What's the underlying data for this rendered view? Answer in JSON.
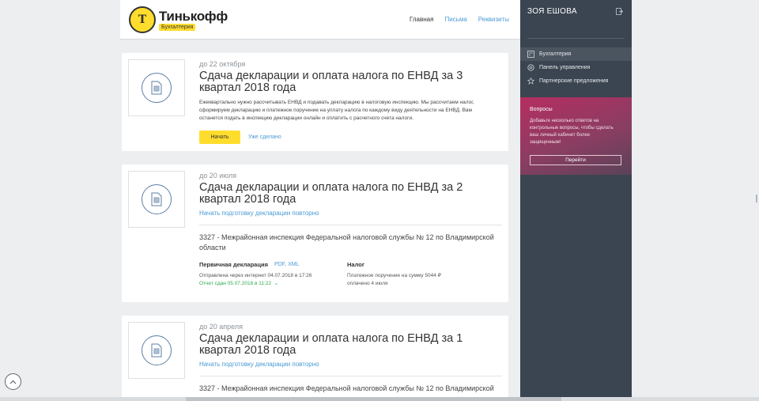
{
  "header": {
    "logo_name": "Тинькофф",
    "logo_badge": "Бухгалтерия",
    "nav": {
      "home": "Главная",
      "letters": "Письма",
      "requisites": "Реквизиты"
    }
  },
  "cards": [
    {
      "due": "до 22 октября",
      "title": "Сдача декларации и оплата налога по ЕНВД за 3 квартал 2018 года",
      "description": "Ежеквартально нужно рассчитывать ЕНВД и подавать декларацию в налоговую инспекцию. Мы рассчитаем налог, сформируем декларацию и платежное поручение на уплату налога по каждому виду деятельности на ЕНВД. Вам останется подать в инспекцию декларации онлайн и оплатить с расчетного счета налоги.",
      "start_label": "Начать",
      "done_label": "Уже сделано"
    },
    {
      "due": "до 20 июля",
      "title": "Сдача декларации и оплата налога по ЕНВД за 2 квартал 2018 года",
      "repeat_link": "Начать подготовку декларации повторно",
      "inspection": "3327 - Межрайонная инспекция Федеральной налоговой службы № 12 по Владимирской области",
      "declaration_head": "Первичная декларация",
      "declaration_files": "PDF, XML",
      "declaration_sent": "Отправлена через интернет 04.07.2018 в 17:26",
      "declaration_report": "Отчет сдан 05.07.2018 в 11:22",
      "tax_head": "Налог",
      "tax_text": "Платежное поручение на сумму 5044 ₽",
      "tax_paid": "оплачено 4 июля"
    },
    {
      "due": "до 20 апреля",
      "title": "Сдача декларации и оплата налога по ЕНВД за 1 квартал 2018 года",
      "repeat_link": "Начать подготовку декларации повторно",
      "inspection": "3327 - Межрайонная инспекция Федеральной налоговой службы № 12 по Владимирской"
    }
  ],
  "sidebar": {
    "user_name": "ЗОЯ ЕШОВА",
    "menu": [
      {
        "label": "Бухгалтерия",
        "icon": "calculator-icon",
        "active": true
      },
      {
        "label": "Панель управления",
        "icon": "gear-icon",
        "active": false
      },
      {
        "label": "Партнерские предложения",
        "icon": "star-icon",
        "active": false
      }
    ],
    "questions": {
      "title": "Вопросы",
      "text": "Добавьте несколько ответов на контрольные вопросы, чтобы сделать ваш личный кабинет более защищенным!",
      "button": "Перейти"
    }
  },
  "colors": {
    "brand_yellow": "#ffdd2d",
    "link_blue": "#4a9bd4",
    "sidebar_bg": "#3b4551",
    "success_green": "#2eaa4c"
  }
}
